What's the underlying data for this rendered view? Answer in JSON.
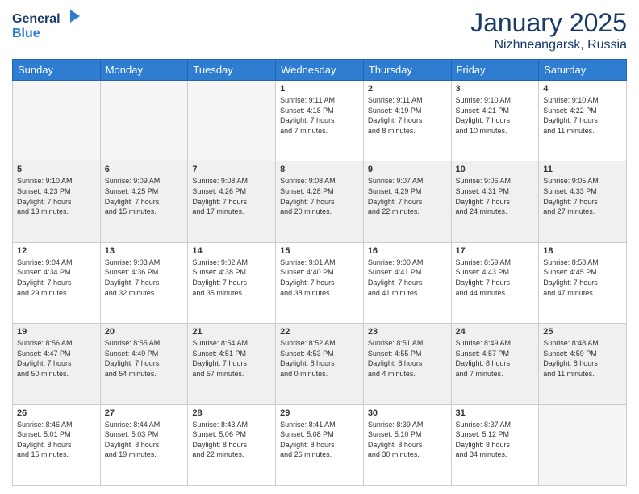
{
  "header": {
    "logo_line1": "General",
    "logo_line2": "Blue",
    "month": "January 2025",
    "location": "Nizhneangarsk, Russia"
  },
  "weekdays": [
    "Sunday",
    "Monday",
    "Tuesday",
    "Wednesday",
    "Thursday",
    "Friday",
    "Saturday"
  ],
  "weeks": [
    [
      {
        "day": "",
        "info": ""
      },
      {
        "day": "",
        "info": ""
      },
      {
        "day": "",
        "info": ""
      },
      {
        "day": "1",
        "info": "Sunrise: 9:11 AM\nSunset: 4:18 PM\nDaylight: 7 hours\nand 7 minutes."
      },
      {
        "day": "2",
        "info": "Sunrise: 9:11 AM\nSunset: 4:19 PM\nDaylight: 7 hours\nand 8 minutes."
      },
      {
        "day": "3",
        "info": "Sunrise: 9:10 AM\nSunset: 4:21 PM\nDaylight: 7 hours\nand 10 minutes."
      },
      {
        "day": "4",
        "info": "Sunrise: 9:10 AM\nSunset: 4:22 PM\nDaylight: 7 hours\nand 11 minutes."
      }
    ],
    [
      {
        "day": "5",
        "info": "Sunrise: 9:10 AM\nSunset: 4:23 PM\nDaylight: 7 hours\nand 13 minutes."
      },
      {
        "day": "6",
        "info": "Sunrise: 9:09 AM\nSunset: 4:25 PM\nDaylight: 7 hours\nand 15 minutes."
      },
      {
        "day": "7",
        "info": "Sunrise: 9:08 AM\nSunset: 4:26 PM\nDaylight: 7 hours\nand 17 minutes."
      },
      {
        "day": "8",
        "info": "Sunrise: 9:08 AM\nSunset: 4:28 PM\nDaylight: 7 hours\nand 20 minutes."
      },
      {
        "day": "9",
        "info": "Sunrise: 9:07 AM\nSunset: 4:29 PM\nDaylight: 7 hours\nand 22 minutes."
      },
      {
        "day": "10",
        "info": "Sunrise: 9:06 AM\nSunset: 4:31 PM\nDaylight: 7 hours\nand 24 minutes."
      },
      {
        "day": "11",
        "info": "Sunrise: 9:05 AM\nSunset: 4:33 PM\nDaylight: 7 hours\nand 27 minutes."
      }
    ],
    [
      {
        "day": "12",
        "info": "Sunrise: 9:04 AM\nSunset: 4:34 PM\nDaylight: 7 hours\nand 29 minutes."
      },
      {
        "day": "13",
        "info": "Sunrise: 9:03 AM\nSunset: 4:36 PM\nDaylight: 7 hours\nand 32 minutes."
      },
      {
        "day": "14",
        "info": "Sunrise: 9:02 AM\nSunset: 4:38 PM\nDaylight: 7 hours\nand 35 minutes."
      },
      {
        "day": "15",
        "info": "Sunrise: 9:01 AM\nSunset: 4:40 PM\nDaylight: 7 hours\nand 38 minutes."
      },
      {
        "day": "16",
        "info": "Sunrise: 9:00 AM\nSunset: 4:41 PM\nDaylight: 7 hours\nand 41 minutes."
      },
      {
        "day": "17",
        "info": "Sunrise: 8:59 AM\nSunset: 4:43 PM\nDaylight: 7 hours\nand 44 minutes."
      },
      {
        "day": "18",
        "info": "Sunrise: 8:58 AM\nSunset: 4:45 PM\nDaylight: 7 hours\nand 47 minutes."
      }
    ],
    [
      {
        "day": "19",
        "info": "Sunrise: 8:56 AM\nSunset: 4:47 PM\nDaylight: 7 hours\nand 50 minutes."
      },
      {
        "day": "20",
        "info": "Sunrise: 8:55 AM\nSunset: 4:49 PM\nDaylight: 7 hours\nand 54 minutes."
      },
      {
        "day": "21",
        "info": "Sunrise: 8:54 AM\nSunset: 4:51 PM\nDaylight: 7 hours\nand 57 minutes."
      },
      {
        "day": "22",
        "info": "Sunrise: 8:52 AM\nSunset: 4:53 PM\nDaylight: 8 hours\nand 0 minutes."
      },
      {
        "day": "23",
        "info": "Sunrise: 8:51 AM\nSunset: 4:55 PM\nDaylight: 8 hours\nand 4 minutes."
      },
      {
        "day": "24",
        "info": "Sunrise: 8:49 AM\nSunset: 4:57 PM\nDaylight: 8 hours\nand 7 minutes."
      },
      {
        "day": "25",
        "info": "Sunrise: 8:48 AM\nSunset: 4:59 PM\nDaylight: 8 hours\nand 11 minutes."
      }
    ],
    [
      {
        "day": "26",
        "info": "Sunrise: 8:46 AM\nSunset: 5:01 PM\nDaylight: 8 hours\nand 15 minutes."
      },
      {
        "day": "27",
        "info": "Sunrise: 8:44 AM\nSunset: 5:03 PM\nDaylight: 8 hours\nand 19 minutes."
      },
      {
        "day": "28",
        "info": "Sunrise: 8:43 AM\nSunset: 5:06 PM\nDaylight: 8 hours\nand 22 minutes."
      },
      {
        "day": "29",
        "info": "Sunrise: 8:41 AM\nSunset: 5:08 PM\nDaylight: 8 hours\nand 26 minutes."
      },
      {
        "day": "30",
        "info": "Sunrise: 8:39 AM\nSunset: 5:10 PM\nDaylight: 8 hours\nand 30 minutes."
      },
      {
        "day": "31",
        "info": "Sunrise: 8:37 AM\nSunset: 5:12 PM\nDaylight: 8 hours\nand 34 minutes."
      },
      {
        "day": "",
        "info": ""
      }
    ]
  ]
}
